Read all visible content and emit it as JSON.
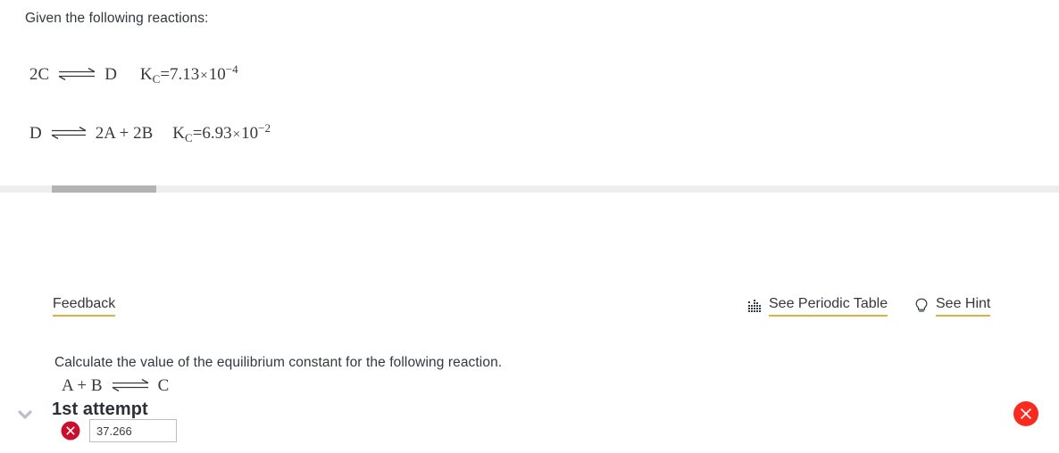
{
  "given": {
    "prompt": "Given the following reactions:",
    "reactions": [
      {
        "left": "2C",
        "arrow": "equilibrium-double-arrow",
        "right": "D",
        "k_label": "K",
        "k_subscript": "C",
        "equals": "=",
        "coefficient": "7.13",
        "times": "×",
        "base": "10",
        "exponent": "−4"
      },
      {
        "left": "D",
        "arrow": "equilibrium-double-arrow",
        "right": "2A + 2B",
        "k_label": "K",
        "k_subscript": "C",
        "equals": "=",
        "coefficient": "6.93",
        "times": "×",
        "base": "10",
        "exponent": "−2"
      }
    ]
  },
  "scrollbar": {
    "orientation": "horizontal",
    "track_color": "#eeeeee",
    "thumb_color": "#b3b3b3"
  },
  "attempt": {
    "title": "1st attempt",
    "chevron_icon": "chevron-down-icon",
    "status_icon": "error-circle-icon",
    "status_color": "#fa2a1e"
  },
  "links": {
    "feedback": "Feedback",
    "periodic_table": "See Periodic Table",
    "periodic_table_icon": "periodic-table-icon",
    "hint": "See Hint",
    "hint_icon": "lightbulb-icon",
    "underline_color": "#d9b441"
  },
  "question": {
    "text": "Calculate the value of the equilibrium constant for the following reaction.",
    "reaction_left": "A + B",
    "reaction_arrow": "equilibrium-double-arrow",
    "reaction_right": "C"
  },
  "answer": {
    "value": "37.266",
    "placeholder": "",
    "status_icon": "error-circle-icon",
    "status_color": "#c8102e"
  }
}
